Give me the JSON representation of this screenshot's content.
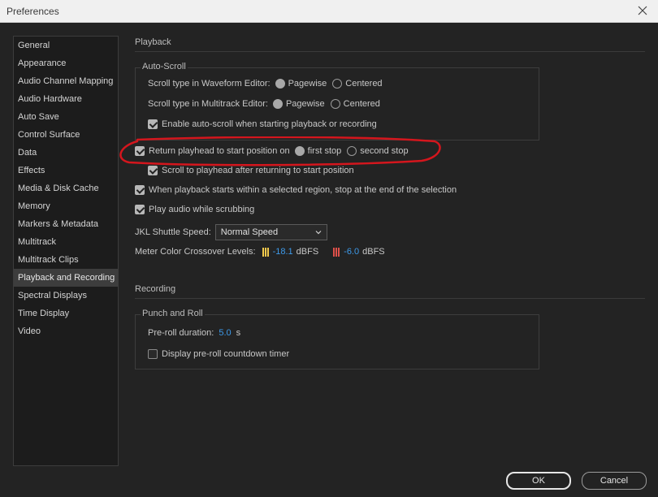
{
  "window": {
    "title": "Preferences"
  },
  "sidebar": {
    "items": [
      {
        "label": "General"
      },
      {
        "label": "Appearance"
      },
      {
        "label": "Audio Channel Mapping"
      },
      {
        "label": "Audio Hardware"
      },
      {
        "label": "Auto Save"
      },
      {
        "label": "Control Surface"
      },
      {
        "label": "Data"
      },
      {
        "label": "Effects"
      },
      {
        "label": "Media & Disk Cache"
      },
      {
        "label": "Memory"
      },
      {
        "label": "Markers & Metadata"
      },
      {
        "label": "Multitrack"
      },
      {
        "label": "Multitrack Clips"
      },
      {
        "label": "Playback and Recording"
      },
      {
        "label": "Spectral Displays"
      },
      {
        "label": "Time Display"
      },
      {
        "label": "Video"
      }
    ],
    "selected": "Playback and Recording"
  },
  "playback": {
    "title": "Playback",
    "autoscroll": {
      "label": "Auto-Scroll",
      "waveform": {
        "label": "Scroll type in Waveform Editor:",
        "opt1": "Pagewise",
        "opt2": "Centered",
        "selected": "Pagewise"
      },
      "multitrack": {
        "label": "Scroll type in Multitrack Editor:",
        "opt1": "Pagewise",
        "opt2": "Centered",
        "selected": "Pagewise"
      },
      "enable": {
        "label": "Enable auto-scroll when starting playback or recording",
        "checked": true
      }
    },
    "return_playhead": {
      "label": "Return playhead to start position on",
      "checked": true,
      "opt1": "first stop",
      "opt2": "second stop",
      "selected": "first stop"
    },
    "scroll_to_playhead": {
      "label": "Scroll to playhead after returning to start position",
      "checked": true
    },
    "stop_at_selection": {
      "label": "When playback starts within a selected region, stop at the end of the selection",
      "checked": true
    },
    "scrub_audio": {
      "label": "Play audio while scrubbing",
      "checked": true
    },
    "jkl": {
      "label": "JKL Shuttle Speed:",
      "value": "Normal Speed"
    },
    "meter": {
      "label": "Meter Color Crossover Levels:",
      "yellow_value": "-18.1",
      "red_value": "-6.0",
      "unit": "dBFS",
      "yellow_color": "#f2c94c",
      "red_color": "#e0504a"
    }
  },
  "recording": {
    "title": "Recording",
    "punch": {
      "label": "Punch and Roll",
      "preroll": {
        "label": "Pre-roll duration:",
        "value": "5.0",
        "unit": "s"
      },
      "countdown": {
        "label": "Display pre-roll countdown timer",
        "checked": false
      }
    }
  },
  "buttons": {
    "ok": "OK",
    "cancel": "Cancel"
  },
  "colors": {
    "annotation": "#d4161d",
    "accent": "#3d9aea"
  }
}
